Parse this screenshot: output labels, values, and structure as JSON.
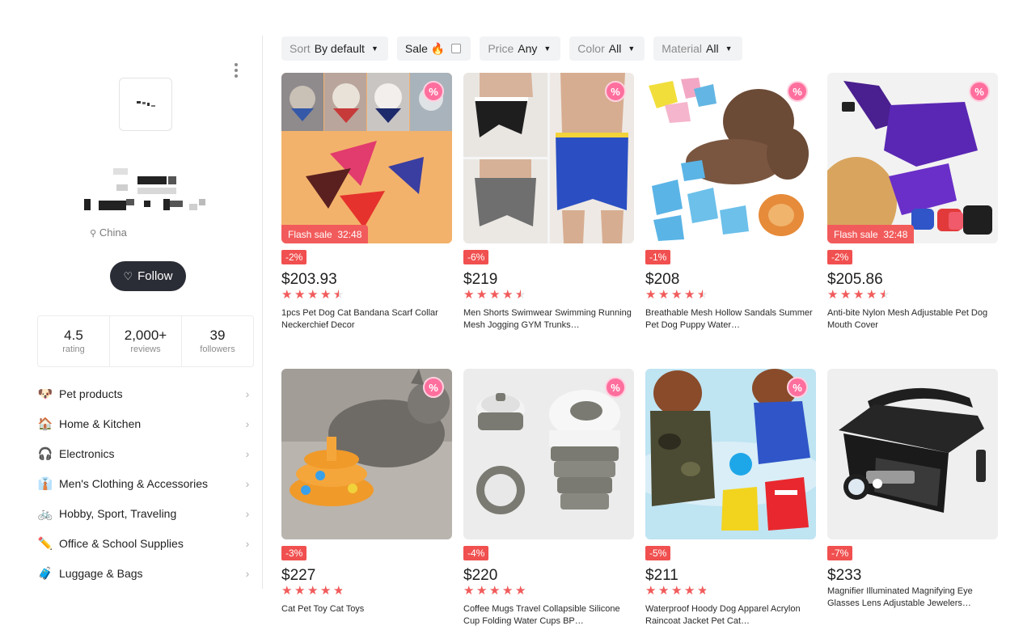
{
  "store": {
    "location": "China",
    "follow_label": "Follow",
    "stats": [
      {
        "value": "4.5",
        "label": "rating"
      },
      {
        "value": "2,000+",
        "label": "reviews"
      },
      {
        "value": "39",
        "label": "followers"
      }
    ],
    "categories": [
      {
        "label": "Pet products",
        "icon": "dog-icon"
      },
      {
        "label": "Home & Kitchen",
        "icon": "house-icon"
      },
      {
        "label": "Electronics",
        "icon": "headphones-icon"
      },
      {
        "label": "Men's Clothing & Accessories",
        "icon": "suit-icon"
      },
      {
        "label": "Hobby, Sport, Traveling",
        "icon": "bicycle-icon"
      },
      {
        "label": "Office & School Supplies",
        "icon": "pencil-icon"
      },
      {
        "label": "Luggage & Bags",
        "icon": "suitcase-icon"
      }
    ]
  },
  "filters": {
    "sort": {
      "key": "Sort",
      "value": "By default"
    },
    "sale": {
      "label": "Sale",
      "icon": "fire-icon",
      "checked": false
    },
    "price": {
      "key": "Price",
      "value": "Any"
    },
    "color": {
      "key": "Color",
      "value": "All"
    },
    "material": {
      "key": "Material",
      "value": "All"
    }
  },
  "flash_label": "Flash sale",
  "badge_icon": "percent-icon",
  "accent_color": "#f25b5b",
  "products": [
    {
      "discount": "-2%",
      "price": "$203.93",
      "rating": 4.5,
      "title": "1pcs Pet Dog Cat Bandana Scarf Collar Neckerchief Decor",
      "flash": "32:48"
    },
    {
      "discount": "-6%",
      "price": "$219",
      "rating": 4.5,
      "title": "Men Shorts Swimwear Swimming Running Mesh Jogging GYM Trunks…",
      "flash": ""
    },
    {
      "discount": "-1%",
      "price": "$208",
      "rating": 4.5,
      "title": "Breathable Mesh Hollow Sandals Summer Pet Dog Puppy Water…",
      "flash": ""
    },
    {
      "discount": "-2%",
      "price": "$205.86",
      "rating": 4.5,
      "title": "Anti-bite Nylon Mesh Adjustable Pet Dog Mouth Cover",
      "flash": "32:48"
    },
    {
      "discount": "-3%",
      "price": "$227",
      "rating": 4.8,
      "title": "Cat Pet Toy Cat Toys",
      "flash": ""
    },
    {
      "discount": "-4%",
      "price": "$220",
      "rating": 5,
      "title": "Coffee Mugs Travel Collapsible Silicone Cup Folding Water Cups BP…",
      "flash": ""
    },
    {
      "discount": "-5%",
      "price": "$211",
      "rating": 4.8,
      "title": "Waterproof Hoody Dog Apparel Acrylon Raincoat Jacket Pet Cat…",
      "flash": ""
    },
    {
      "discount": "-7%",
      "price": "$233",
      "rating": 0,
      "title": "Magnifier Illuminated Magnifying Eye Glasses Lens Adjustable Jewelers…",
      "flash": ""
    }
  ]
}
